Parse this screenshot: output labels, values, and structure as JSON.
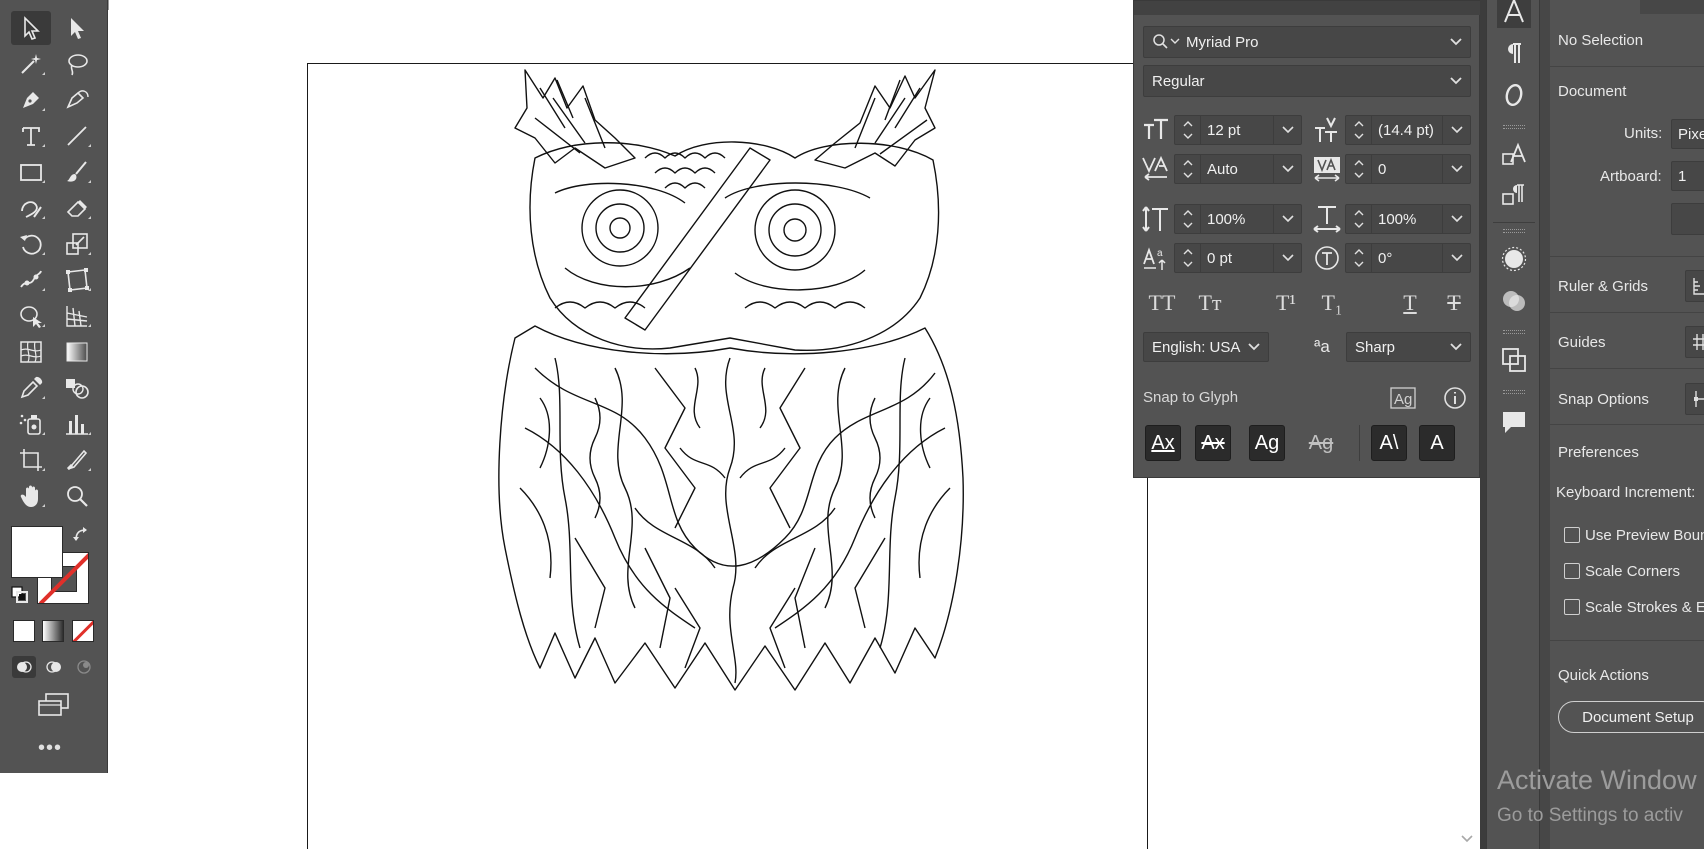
{
  "app": "Adobe Illustrator",
  "toolbar": {
    "tools": [
      {
        "name": "selection-tool",
        "icon": "arrow-pointer-icon"
      },
      {
        "name": "direct-selection-tool",
        "icon": "filled-arrow-icon"
      },
      {
        "name": "magic-wand-tool",
        "icon": "magic-wand-icon"
      },
      {
        "name": "lasso-tool",
        "icon": "lasso-icon"
      },
      {
        "name": "pen-tool",
        "icon": "pen-nib-icon"
      },
      {
        "name": "curvature-tool",
        "icon": "curvature-pen-icon"
      },
      {
        "name": "type-tool",
        "icon": "type-t-icon"
      },
      {
        "name": "line-segment-tool",
        "icon": "line-icon"
      },
      {
        "name": "rectangle-tool",
        "icon": "rectangle-icon"
      },
      {
        "name": "paintbrush-tool",
        "icon": "brush-icon"
      },
      {
        "name": "shaper-tool",
        "icon": "shaper-icon"
      },
      {
        "name": "eraser-tool",
        "icon": "eraser-icon"
      },
      {
        "name": "rotate-tool",
        "icon": "rotate-icon"
      },
      {
        "name": "scale-tool",
        "icon": "scale-icon"
      },
      {
        "name": "puppet-warp-tool",
        "icon": "puppet-warp-icon"
      },
      {
        "name": "free-transform-tool",
        "icon": "free-transform-icon"
      },
      {
        "name": "shape-builder-tool",
        "icon": "shape-builder-icon"
      },
      {
        "name": "perspective-grid-tool",
        "icon": "perspective-grid-icon"
      },
      {
        "name": "mesh-tool",
        "icon": "mesh-icon"
      },
      {
        "name": "gradient-tool",
        "icon": "gradient-icon"
      },
      {
        "name": "eyedropper-tool",
        "icon": "eyedropper-icon"
      },
      {
        "name": "blend-tool",
        "icon": "blend-icon"
      },
      {
        "name": "symbol-sprayer-tool",
        "icon": "symbol-sprayer-icon"
      },
      {
        "name": "column-graph-tool",
        "icon": "bar-graph-icon"
      },
      {
        "name": "artboard-tool",
        "icon": "artboard-icon"
      },
      {
        "name": "slice-tool",
        "icon": "slice-knife-icon"
      },
      {
        "name": "hand-tool",
        "icon": "hand-icon"
      },
      {
        "name": "zoom-tool",
        "icon": "magnifier-icon"
      }
    ],
    "more_label": "•••"
  },
  "character": {
    "font_family": "Myriad Pro",
    "font_style": "Regular",
    "font_size": "12 pt",
    "leading": "(14.4 pt)",
    "kerning": "Auto",
    "tracking": "0",
    "vertical_scale": "100%",
    "horizontal_scale": "100%",
    "baseline_shift": "0 pt",
    "rotation": "0°",
    "language": "English: USA",
    "anti_aliasing": "Sharp",
    "aa_icon_label": "ªa",
    "snap_to_glyph": "Snap to Glyph",
    "buttons": {
      "all_caps": "TT",
      "small_caps": "Tт",
      "superscript": "T¹",
      "subscript": "T₁",
      "underline": "T",
      "strikethrough": "T"
    },
    "snap_buttons": [
      "Ax",
      "Ax",
      "Ag",
      "Ag",
      "A\\",
      "A"
    ]
  },
  "properties": {
    "selection": "No Selection",
    "document": "Document",
    "units_label": "Units:",
    "units_value": "Pixe",
    "artboard_label": "Artboard:",
    "artboard_value": "1",
    "ruler_grids": "Ruler & Grids",
    "guides": "Guides",
    "snap_options": "Snap Options",
    "preferences": "Preferences",
    "keyboard_increment": "Keyboard Increment:",
    "use_preview_bounds": "Use Preview Boun",
    "scale_corners": "Scale Corners",
    "scale_strokes": "Scale Strokes & Ef",
    "quick_actions": "Quick Actions",
    "document_setup": "Document Setup"
  },
  "watermark": {
    "title": "Activate Window",
    "subtitle": "Go to Settings to activ"
  },
  "colors": {
    "panel": "#535353",
    "field": "#474747",
    "artboard": "#ffffff",
    "none_red": "#e0302a"
  }
}
